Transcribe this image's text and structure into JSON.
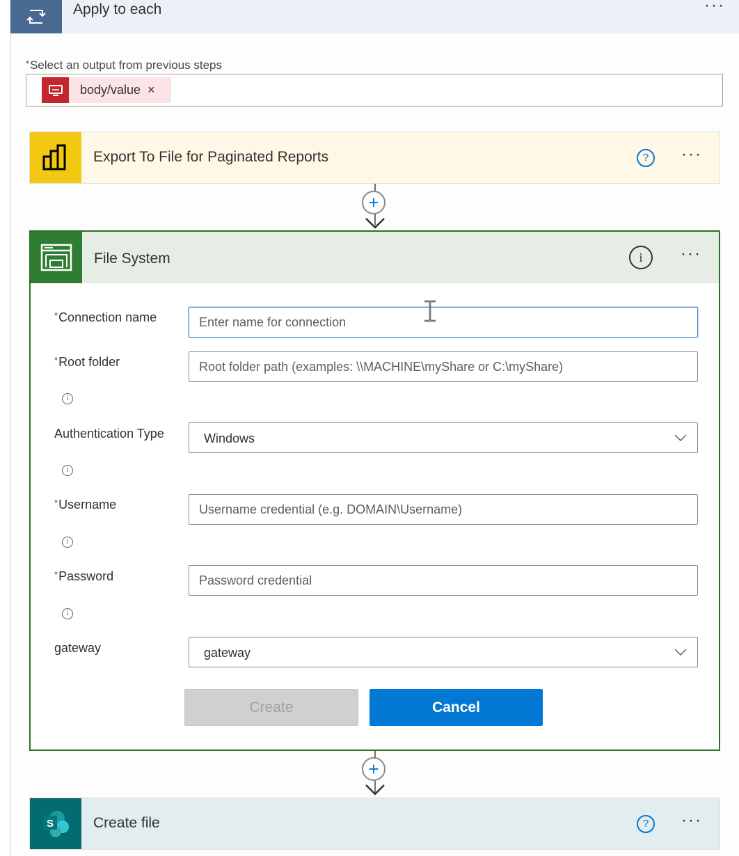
{
  "loop": {
    "title": "Apply to each",
    "icon": "loop-icon",
    "more": "···"
  },
  "select_output": {
    "required_mark": "*",
    "label": "Select an output from previous steps",
    "token": {
      "label": "body/value",
      "remove": "×",
      "icon": "report-icon"
    }
  },
  "export_step": {
    "title": "Export To File for Paginated Reports",
    "help": "?",
    "more": "···",
    "color": "#f2c811",
    "header_bg": "#fff8e6"
  },
  "connector": {
    "plus": "+"
  },
  "file_system": {
    "title": "File System",
    "info": "i",
    "more": "···",
    "color": "#2f7d32",
    "fields": {
      "connection_name": {
        "required": "*",
        "label": "Connection name",
        "placeholder": "Enter name for connection"
      },
      "root_folder": {
        "required": "*",
        "label": "Root folder",
        "placeholder": "Root folder path (examples: \\\\MACHINE\\myShare or C:\\myShare)"
      },
      "auth_type": {
        "label": "Authentication Type",
        "value": "Windows"
      },
      "username": {
        "required": "*",
        "label": "Username",
        "placeholder": "Username credential (e.g. DOMAIN\\Username)"
      },
      "password": {
        "required": "*",
        "label": "Password",
        "placeholder": "Password credential"
      },
      "gateway": {
        "label": "gateway",
        "value": "gateway"
      }
    },
    "info_glyph": "i",
    "buttons": {
      "create": "Create",
      "cancel": "Cancel"
    }
  },
  "create_file_step": {
    "title": "Create file",
    "help": "?",
    "more": "···",
    "icon_letter": "S",
    "color": "#036c70"
  }
}
